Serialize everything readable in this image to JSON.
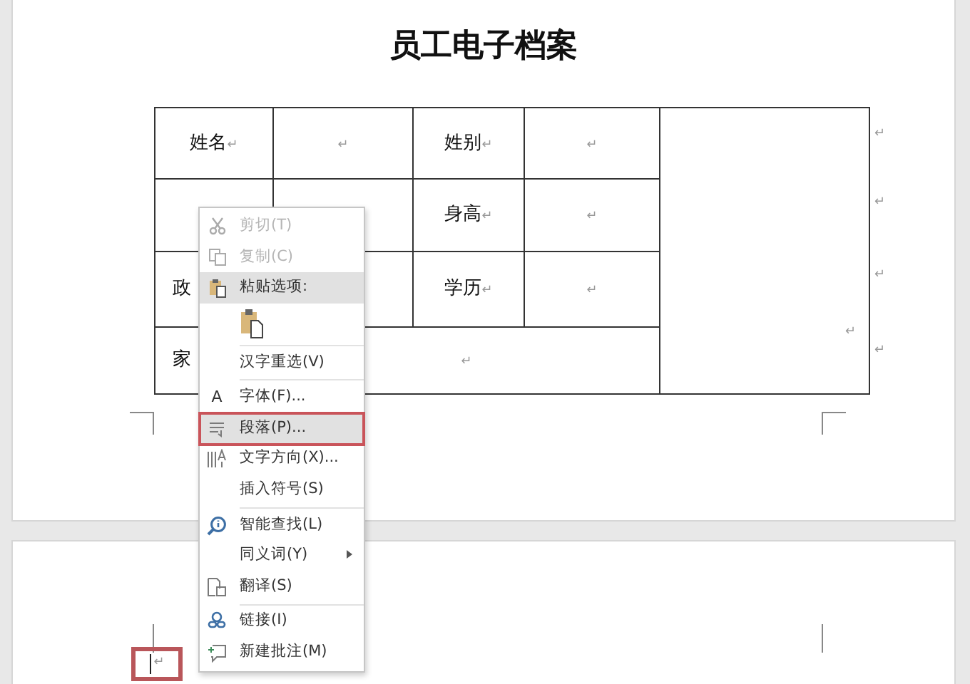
{
  "document": {
    "title": "员工电子档案",
    "table": {
      "rows": [
        {
          "cells": [
            {
              "text": "姓名",
              "mark": "↵"
            },
            {
              "mark": "↵"
            },
            {
              "text": "姓别",
              "mark": "↵"
            },
            {
              "mark": "↵"
            }
          ],
          "end_mark": "↵"
        },
        {
          "cells": [
            {},
            {},
            {
              "text": "身高",
              "mark": "↵"
            },
            {
              "mark": "↵"
            }
          ],
          "end_mark": "↵"
        },
        {
          "cells": [
            {
              "text": "政"
            },
            {},
            {
              "text": "学历",
              "mark": "↵"
            },
            {
              "mark": "↵"
            }
          ],
          "end_mark": "↵"
        },
        {
          "cells": [
            {
              "text": "家"
            },
            {
              "mark": "↵",
              "colspan": 3
            }
          ],
          "end_mark": "↵"
        }
      ],
      "photo_cell": {
        "mark": "↵"
      }
    }
  },
  "context_menu": {
    "items": [
      {
        "kind": "command",
        "label": "剪切(T)",
        "disabled": true,
        "selected": false,
        "annotated": false
      },
      {
        "kind": "command",
        "label": "复制(C)",
        "disabled": true,
        "selected": false,
        "annotated": false
      },
      {
        "kind": "header",
        "label": "粘贴选项:",
        "selected": true
      },
      {
        "kind": "paste_options"
      },
      {
        "kind": "separator"
      },
      {
        "kind": "command",
        "label": "汉字重选(V)",
        "disabled": false,
        "selected": false,
        "annotated": false
      },
      {
        "kind": "separator"
      },
      {
        "kind": "command",
        "label": "字体(F)...",
        "glyph": "A",
        "disabled": false,
        "selected": false,
        "annotated": false
      },
      {
        "kind": "command",
        "label": "段落(P)...",
        "disabled": false,
        "selected": true,
        "annotated": true
      },
      {
        "kind": "command",
        "label": "文字方向(X)...",
        "disabled": false,
        "selected": false,
        "annotated": false
      },
      {
        "kind": "command",
        "label": "插入符号(S)",
        "disabled": false,
        "selected": false,
        "annotated": false
      },
      {
        "kind": "separator"
      },
      {
        "kind": "command",
        "label": "智能查找(L)",
        "disabled": false,
        "selected": false,
        "annotated": false
      },
      {
        "kind": "command",
        "label": "同义词(Y)",
        "submenu": true,
        "disabled": false,
        "selected": false,
        "annotated": false
      },
      {
        "kind": "command",
        "label": "翻译(S)",
        "disabled": false,
        "selected": false,
        "annotated": false
      },
      {
        "kind": "separator"
      },
      {
        "kind": "command",
        "label": "链接(I)",
        "disabled": false,
        "selected": false,
        "annotated": false
      },
      {
        "kind": "command",
        "label": "新建批注(M)",
        "disabled": false,
        "selected": false,
        "annotated": false
      }
    ]
  },
  "second_page": {
    "mark": "↵",
    "annotated": true
  }
}
